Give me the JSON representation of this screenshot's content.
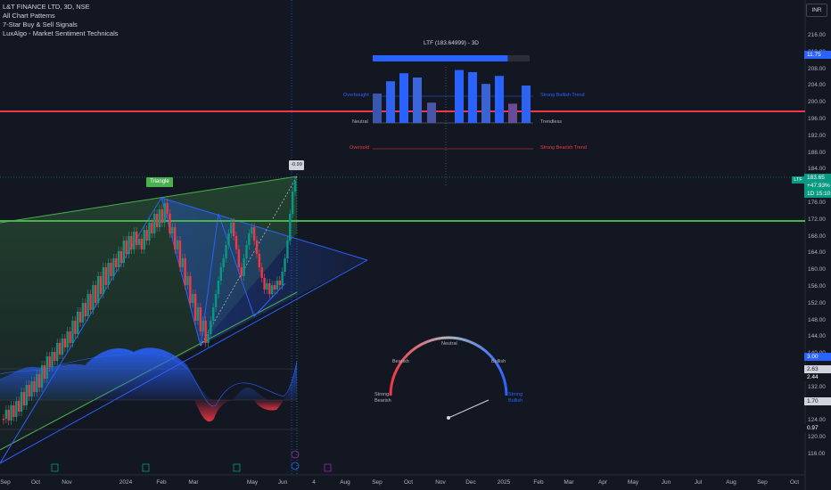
{
  "header": {
    "symbol_line": "L&T FINANCE LTD, 3D, NSE",
    "indicators": [
      "All Chart Patterns",
      "7-Star Buy & Sell Signals",
      "LuxAlgo - Market Sentiment Technicals"
    ]
  },
  "currency": "INR",
  "y_axis_labels": [
    "216.00",
    "212.00",
    "208.00",
    "204.00",
    "200.00",
    "196.00",
    "192.00",
    "188.00",
    "184.00",
    "180.00",
    "176.00",
    "172.00",
    "168.00",
    "164.00",
    "160.00",
    "156.00",
    "152.00",
    "148.00",
    "144.00",
    "140.00",
    "136.00",
    "132.00",
    "128.00",
    "124.00",
    "120.00",
    "116.00"
  ],
  "x_axis_labels": [
    "Sep",
    "Oct",
    "Nov",
    "2024",
    "Feb",
    "Mar",
    "May",
    "Jun",
    "4",
    "Aug",
    "Sep",
    "Oct",
    "Nov",
    "Dec",
    "2025",
    "Feb",
    "Mar",
    "Apr",
    "May",
    "Jun",
    "Jul",
    "Aug",
    "Sep",
    "Oct"
  ],
  "price_tags": {
    "symbol": "LTF",
    "last_price": "183.65",
    "change": "+47.93%",
    "time_left": "1D 15:10",
    "level_top": "11.75",
    "osc_1": "3.00",
    "osc_2": "2.63",
    "osc_3": "2.44",
    "osc_4": "1.70",
    "osc_5": "0.97"
  },
  "pattern_label": "Triangle",
  "current_price_callout": "-0.99",
  "sentiment_panel": {
    "title": "LTF (183.64999) - 3D",
    "left_labels": [
      "Overbought",
      "Neutral",
      "Oversold"
    ],
    "right_labels": [
      "Strong Bullish Trend",
      "Trendless",
      "Strong Bearish Trend"
    ],
    "bar_values": [
      0.55,
      0.78,
      0.93,
      0.85,
      0.38,
      0.99,
      0.95,
      0.73,
      0.88,
      0.36,
      0.7
    ],
    "bar_colors": [
      "#3a57b0",
      "#2d63f0",
      "#2962ff",
      "#3a66d9",
      "#4a54a8",
      "#2962ff",
      "#2962ff",
      "#3a64d1",
      "#2962ff",
      "#6a4c96",
      "#2d63f0"
    ],
    "progress_fraction": 0.86
  },
  "gauge": {
    "labels": [
      "Strong Bearish",
      "Bearish",
      "Neutral",
      "Bullish",
      "Strong Bullish"
    ],
    "needle_value": 0.86
  },
  "colors": {
    "background": "#131722",
    "bull": "#089981",
    "bear": "#f23645",
    "resistance_line": "#f23645",
    "support_line": "#4caf50",
    "triangle_blue": "#2962ff"
  }
}
